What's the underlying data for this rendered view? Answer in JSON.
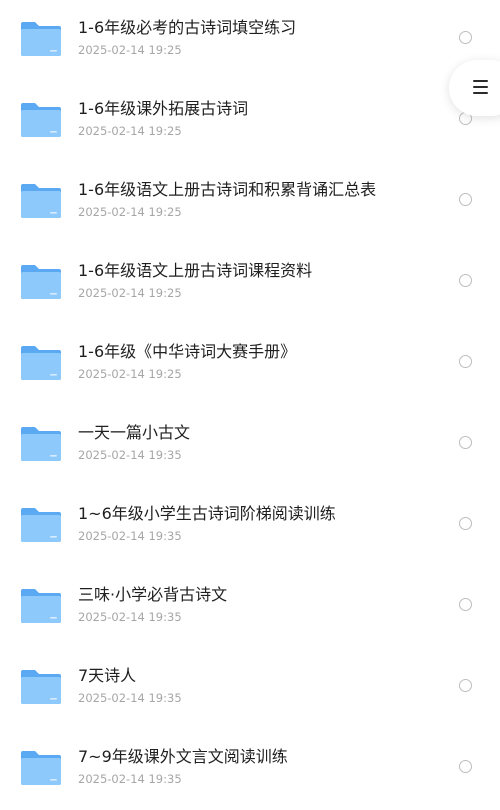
{
  "files": [
    {
      "name": "1-6年级必考的古诗词填空练习",
      "date": "2025-02-14 19:25"
    },
    {
      "name": "1-6年级课外拓展古诗词",
      "date": "2025-02-14 19:25"
    },
    {
      "name": "1-6年级语文上册古诗词和积累背诵汇总表",
      "date": "2025-02-14 19:25"
    },
    {
      "name": "1-6年级语文上册古诗词课程资料",
      "date": "2025-02-14 19:25"
    },
    {
      "name": "1-6年级《中华诗词大赛手册》",
      "date": "2025-02-14 19:25"
    },
    {
      "name": "一天一篇小古文",
      "date": "2025-02-14 19:35"
    },
    {
      "name": "1~6年级小学生古诗词阶梯阅读训练",
      "date": "2025-02-14 19:35"
    },
    {
      "name": "三味·小学必背古诗文",
      "date": "2025-02-14 19:35"
    },
    {
      "name": "7天诗人",
      "date": "2025-02-14 19:35"
    },
    {
      "name": "7~9年级课外文言文阅读训练",
      "date": "2025-02-14 19:35"
    }
  ],
  "icons": {
    "folder": "folder-icon",
    "select": "radio-circle-icon",
    "menu": "menu-icon"
  },
  "colors": {
    "folder_back": "#5aa9f2",
    "folder_front": "#8ec9fb",
    "title_text": "#1f1f1f",
    "date_text": "#a6a6a6",
    "radio_border": "#bdbdbd"
  }
}
